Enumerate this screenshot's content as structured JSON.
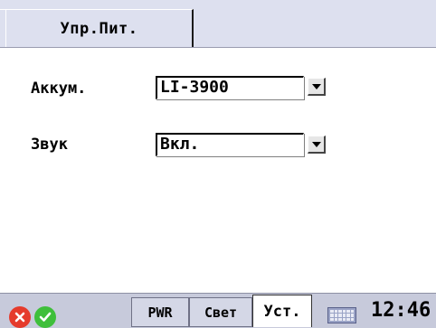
{
  "tabs": {
    "power": "Упр.Пит."
  },
  "fields": [
    {
      "label": "Аккум.",
      "value": "LI-3900"
    },
    {
      "label": "Звук",
      "value": "Вкл."
    }
  ],
  "taskbar": {
    "pwr": "PWR",
    "light": "Свет",
    "setup": "Уст.",
    "time": "12:46",
    "icons": [
      "close-icon",
      "check-icon",
      "keyboard-icon"
    ]
  },
  "colors": {
    "close": "#e53b2c",
    "ok": "#3fbf3b",
    "taskbar": "#c7cadb",
    "tabstrip": "#dde0ef"
  }
}
